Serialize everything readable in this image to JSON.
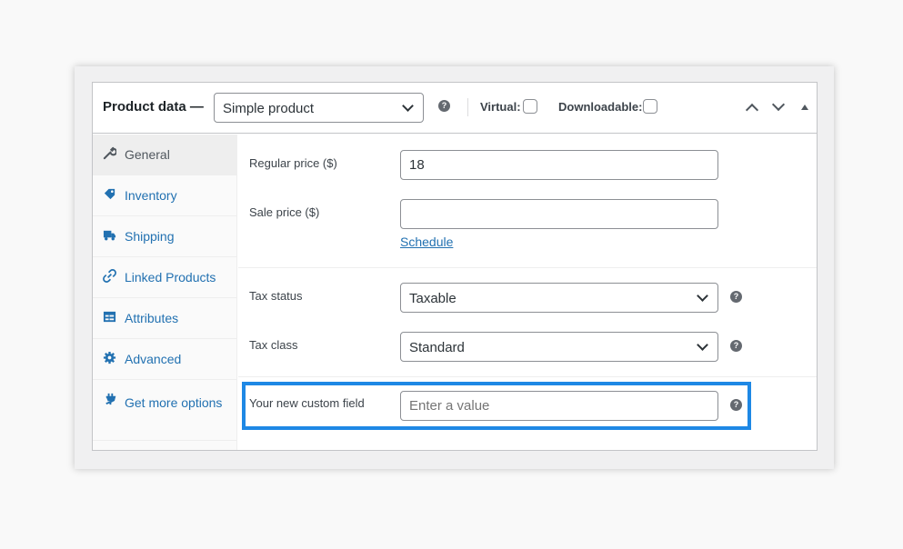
{
  "header": {
    "title": "Product data —",
    "product_type": "Simple product",
    "virtual_label": "Virtual:",
    "downloadable_label": "Downloadable:",
    "help_glyph": "?"
  },
  "tabs": [
    {
      "label": "General",
      "icon": "wrench-icon",
      "active": true
    },
    {
      "label": "Inventory",
      "icon": "tag-icon",
      "active": false
    },
    {
      "label": "Shipping",
      "icon": "truck-icon",
      "active": false
    },
    {
      "label": "Linked Products",
      "icon": "link-icon",
      "active": false
    },
    {
      "label": "Attributes",
      "icon": "table-icon",
      "active": false
    },
    {
      "label": "Advanced",
      "icon": "gear-icon",
      "active": false
    },
    {
      "label": "Get more options",
      "icon": "plugin-icon",
      "active": false
    }
  ],
  "pricing": {
    "regular_price_label": "Regular price ($)",
    "regular_price_value": "18",
    "sale_price_label": "Sale price ($)",
    "sale_price_value": "",
    "schedule_link": "Schedule"
  },
  "tax": {
    "status_label": "Tax status",
    "status_value": "Taxable",
    "class_label": "Tax class",
    "class_value": "Standard"
  },
  "custom": {
    "label": "Your new custom field",
    "placeholder": "Enter a value"
  },
  "colors": {
    "link": "#2271b1",
    "highlight": "#1e88e5",
    "border": "#c3c4c7"
  }
}
